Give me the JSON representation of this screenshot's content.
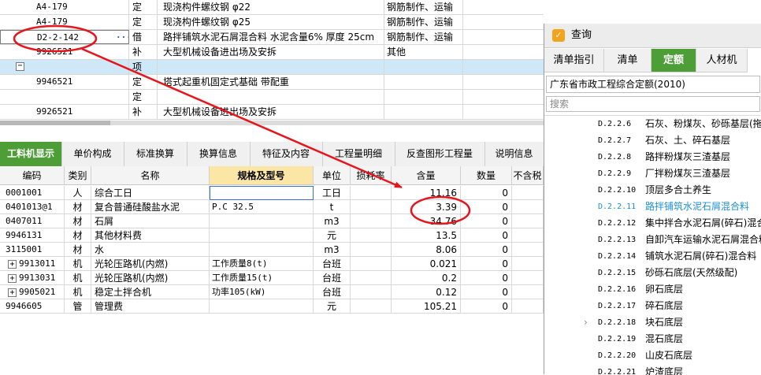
{
  "top_grid": {
    "rows": [
      {
        "code": "A4-179",
        "type": "定",
        "name": "现浇构件螺纹钢 φ22",
        "spec": "钢筋制作、运输"
      },
      {
        "code": "A4-179",
        "type": "定",
        "name": "现浇构件螺纹钢 φ25",
        "spec": "钢筋制作、运输"
      },
      {
        "code": "D2-2-142",
        "type": "借",
        "name": "路拌铺筑水泥石屑混合料 水泥含量6% 厚度 25cm",
        "spec": "钢筋制作、运输",
        "dots": "···"
      },
      {
        "code": "9926521",
        "type": "补",
        "name": "大型机械设备进出场及安拆",
        "spec": "其他"
      },
      {
        "code": "",
        "type": "项",
        "name": "",
        "spec": "",
        "expand": "−"
      },
      {
        "code": "9946521",
        "type": "定",
        "name": "塔式起重机固定式基础 带配重",
        "spec": ""
      },
      {
        "code": "",
        "type": "定",
        "name": "",
        "spec": ""
      },
      {
        "code": "9926521",
        "type": "补",
        "name": "大型机械设备进出场及安拆",
        "spec": ""
      }
    ]
  },
  "tabs": [
    {
      "label": "工料机显示",
      "active": true
    },
    {
      "label": "单价构成"
    },
    {
      "label": "标准换算"
    },
    {
      "label": "换算信息"
    },
    {
      "label": "特征及内容"
    },
    {
      "label": "工程量明细"
    },
    {
      "label": "反查图形工程量"
    },
    {
      "label": "说明信息"
    }
  ],
  "bottom_grid": {
    "headers": [
      "编码",
      "类别",
      "名称",
      "规格及型号",
      "单位",
      "损耗率",
      "含量",
      "数量",
      "不含税"
    ],
    "rows": [
      {
        "code": "0001001",
        "cat": "人",
        "name": "综合工日",
        "spec": "",
        "unit": "工日",
        "qty": "11.16",
        "amt": "0"
      },
      {
        "code": "0401013@1",
        "cat": "材",
        "name": "复合普通硅酸盐水泥",
        "spec": "P.C  32.5",
        "unit": "t",
        "qty": "3.39",
        "amt": "0"
      },
      {
        "code": "0407011",
        "cat": "材",
        "name": "石屑",
        "spec": "",
        "unit": "m3",
        "qty": "34.76",
        "amt": "0"
      },
      {
        "code": "9946131",
        "cat": "材",
        "name": "其他材料费",
        "spec": "",
        "unit": "元",
        "qty": "13.5",
        "amt": "0"
      },
      {
        "code": "3115001",
        "cat": "材",
        "name": "水",
        "spec": "",
        "unit": "m3",
        "qty": "8.06",
        "amt": "0"
      },
      {
        "code": "9913011",
        "cat": "机",
        "name": "光轮压路机(内燃)",
        "spec": "工作质量8(t)",
        "unit": "台班",
        "qty": "0.021",
        "amt": "0",
        "expand": "+"
      },
      {
        "code": "9913031",
        "cat": "机",
        "name": "光轮压路机(内燃)",
        "spec": "工作质量15(t)",
        "unit": "台班",
        "qty": "0.2",
        "amt": "0",
        "expand": "+"
      },
      {
        "code": "9905021",
        "cat": "机",
        "name": "稳定土拌合机",
        "spec": "功率105(kW)",
        "unit": "台班",
        "qty": "0.12",
        "amt": "0",
        "expand": "+"
      },
      {
        "code": "9946605",
        "cat": "管",
        "name": "管理费",
        "spec": "",
        "unit": "元",
        "qty": "105.21",
        "amt": "0"
      }
    ]
  },
  "query_panel": {
    "title": "查询",
    "icon": "query-icon",
    "tabs": [
      {
        "label": "清单指引"
      },
      {
        "label": "清单"
      },
      {
        "label": "定额",
        "active": true
      },
      {
        "label": "人材机"
      }
    ],
    "quota_library": "广东省市政工程综合定额(2010)",
    "search_placeholder": "搜索",
    "tree": [
      {
        "code": "D.2.2.6",
        "name": "石灰、粉煤灰、砂砾基层(拖拉"
      },
      {
        "code": "D.2.2.7",
        "name": "石灰、土、碎石基层"
      },
      {
        "code": "D.2.2.8",
        "name": "路拌粉煤灰三渣基层"
      },
      {
        "code": "D.2.2.9",
        "name": "厂拌粉煤灰三渣基层"
      },
      {
        "code": "D.2.2.10",
        "name": "顶层多合土养生"
      },
      {
        "code": "D.2.2.11",
        "name": "路拌铺筑水泥石屑混合料",
        "active": true
      },
      {
        "code": "D.2.2.12",
        "name": "集中拌合水泥石屑(碎石)混合"
      },
      {
        "code": "D.2.2.13",
        "name": "自卸汽车运输水泥石屑混合料"
      },
      {
        "code": "D.2.2.14",
        "name": "铺筑水泥石屑(碎石)混合料"
      },
      {
        "code": "D.2.2.15",
        "name": "砂砾石底层(天然级配)"
      },
      {
        "code": "D.2.2.16",
        "name": "卵石底层"
      },
      {
        "code": "D.2.2.17",
        "name": "碎石底层"
      },
      {
        "code": "D.2.2.18",
        "name": "块石底层",
        "chevron": "›"
      },
      {
        "code": "D.2.2.19",
        "name": "混石底层"
      },
      {
        "code": "D.2.2.20",
        "name": "山皮石底层"
      },
      {
        "code": "D.2.2.21",
        "name": "炉渣底层"
      }
    ]
  },
  "annotation_color": "#e8141c"
}
